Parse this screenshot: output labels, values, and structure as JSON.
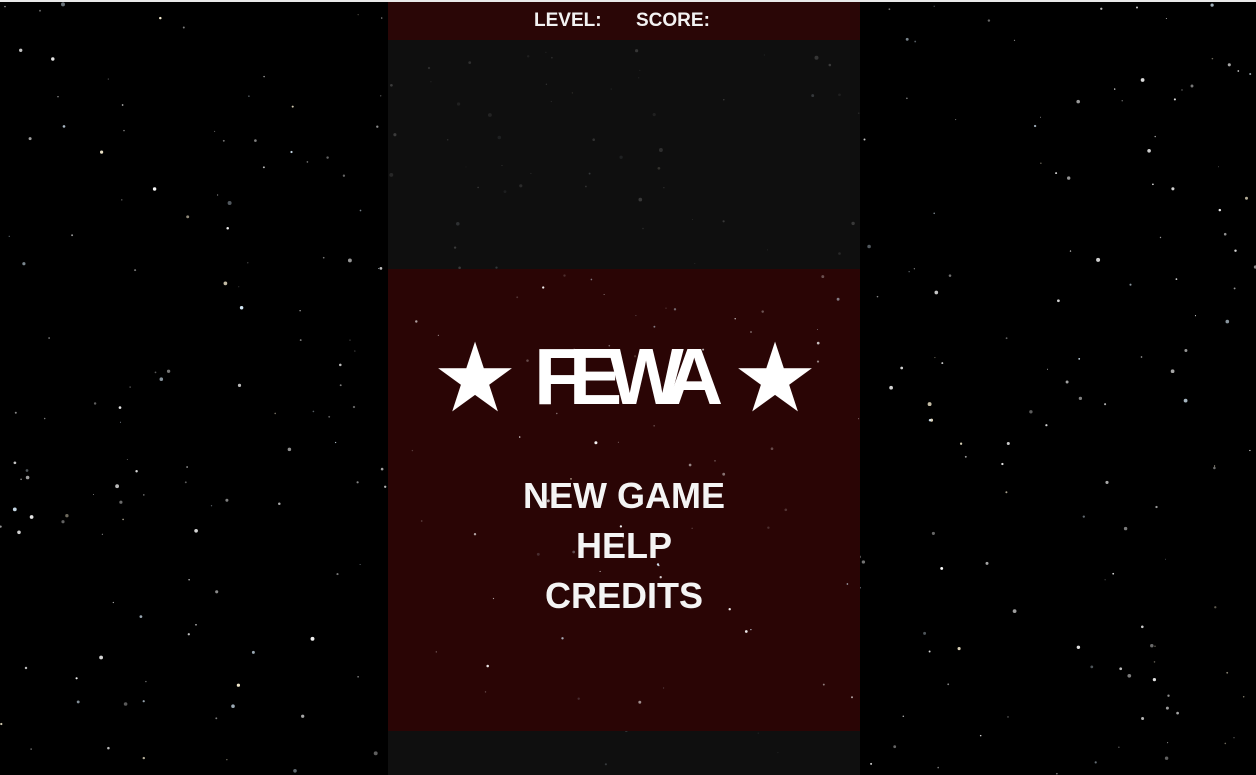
{
  "hud": {
    "level_label": "LEVEL:",
    "score_label": "SCORE:"
  },
  "title": {
    "left_icon": "star-icon",
    "text": "FEWA",
    "right_icon": "star-icon"
  },
  "menu": {
    "items": [
      {
        "label": "NEW GAME"
      },
      {
        "label": "HELP"
      },
      {
        "label": "CREDITS"
      }
    ]
  },
  "colors": {
    "background": "#000000",
    "column": "#121212",
    "panel": "#2a0505",
    "hud": "#2a0606",
    "text": "#ffffff"
  }
}
